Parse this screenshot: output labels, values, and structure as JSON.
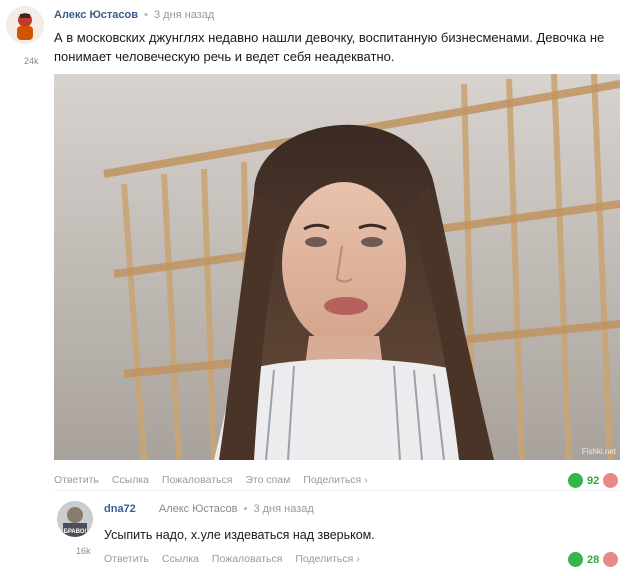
{
  "post": {
    "author": "Алекс Юстасов",
    "separator": "•",
    "time": "3 дня назад",
    "karma": "24k",
    "text": "А в московских джунглях недавно нашли девочку, воспитанную бизнесменами. Девочка не понимает человеческую речь и ведет себя неадекватно.",
    "image_watermark": "Fishki.net",
    "actions": [
      "Ответить",
      "Ссылка",
      "Пожаловаться",
      "Это спам",
      "Поделиться ›"
    ],
    "score": "92",
    "avatar_icon": "avatar-icon",
    "vote_up_color": "#36b54a",
    "vote_down_color": "#e98887"
  },
  "reply": {
    "author": "dna72",
    "reply_to": "Алекс Юстасов",
    "separator": "•",
    "time": "3 дня назад",
    "karma": "16k",
    "avatar_text": "БРАВО!",
    "text": "Усыпить надо, х.уле издеваться над зверьком.",
    "actions": [
      "Ответить",
      "Ссылка",
      "Пожаловаться",
      "Поделиться ›"
    ],
    "score": "28"
  }
}
